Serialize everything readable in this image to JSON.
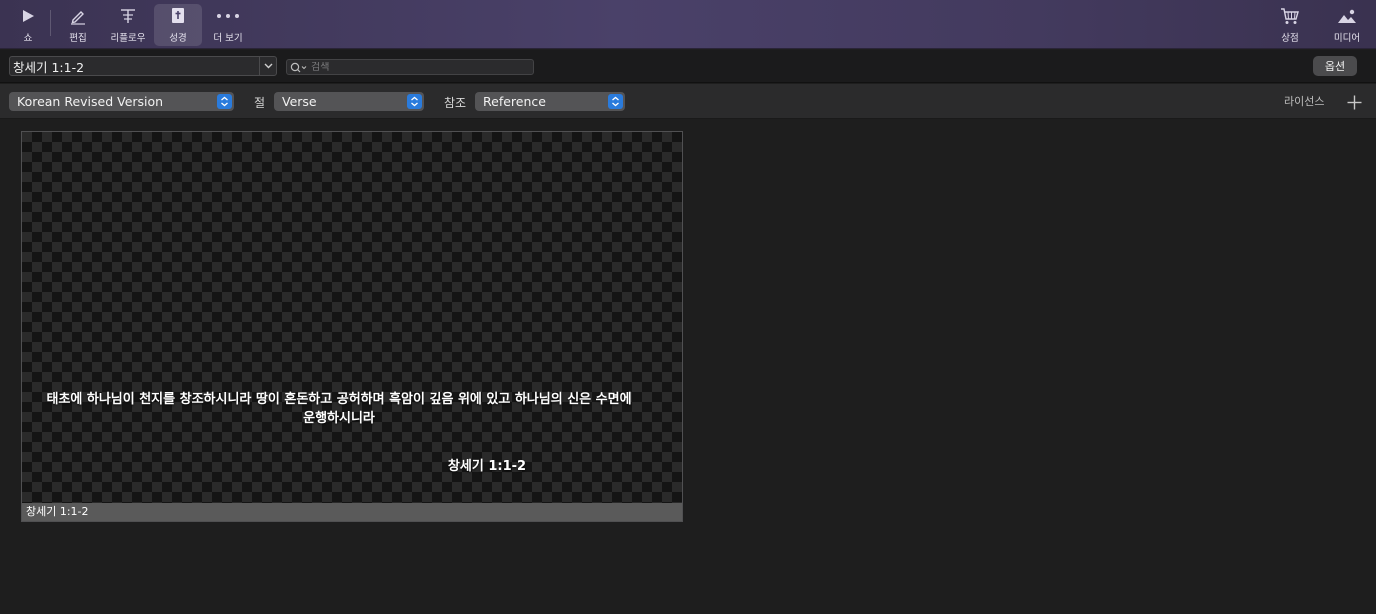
{
  "toolbar": {
    "show": {
      "label": "쇼",
      "icon": "play-icon"
    },
    "edit": {
      "label": "편집",
      "icon": "pencil-icon"
    },
    "reflow": {
      "label": "리플로우",
      "icon": "reflow-icon"
    },
    "bible": {
      "label": "성경",
      "icon": "bible-icon",
      "active": true
    },
    "more": {
      "label": "더 보기",
      "icon": "ellipsis-icon"
    },
    "store": {
      "label": "상점",
      "icon": "cart-icon"
    },
    "media": {
      "label": "미디어",
      "icon": "media-icon"
    }
  },
  "reference": {
    "value": "창세기 1:1-2",
    "search_placeholder": "검색",
    "options_label": "옵션"
  },
  "selectors": {
    "translation": "Korean Revised Version",
    "verse_label": "절",
    "verse_value": "Verse",
    "reference_label": "참조",
    "reference_value": "Reference",
    "license_label": "라이선스"
  },
  "slide": {
    "verse_text": "태초에 하나님이 천지를 창조하시니라 땅이 혼돈하고 공허하며 흑암이 깊음 위에 있고 하나님의 신은 수면에 운행하시니라",
    "reference": "창세기 1:1-2",
    "caption": "창세기 1:1-2"
  },
  "colors": {
    "accent": "#2a7bdc",
    "toolbar_bg": "#4a4169"
  }
}
